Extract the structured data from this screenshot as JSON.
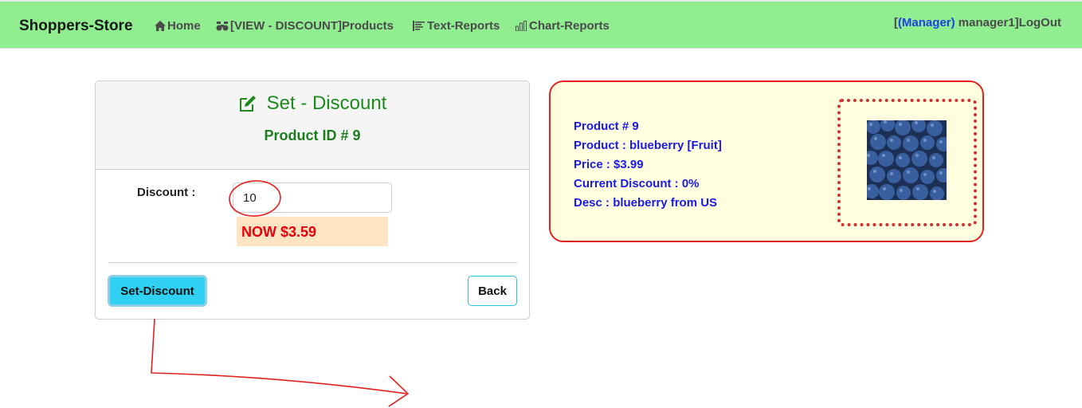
{
  "navbar": {
    "brand": "Shoppers-Store",
    "links": [
      {
        "label": "Home",
        "icon": "home-icon"
      },
      {
        "label": "[VIEW - DISCOUNT]Products",
        "icon": "binoculars-icon"
      },
      {
        "label": "Text-Reports",
        "icon": "text-report-icon"
      },
      {
        "label": "Chart-Reports",
        "icon": "bar-chart-icon"
      }
    ],
    "user": {
      "open": "[",
      "role": "(Manager)",
      "name": " manager1]",
      "logout": "LogOut"
    }
  },
  "form": {
    "title": "Set - Discount",
    "subtitle": "Product ID # 9",
    "discount_label": "Discount :",
    "discount_value": "10",
    "now_price": "NOW $3.59",
    "submit_label": "Set-Discount",
    "back_label": "Back"
  },
  "product": {
    "lines": [
      "Product # 9",
      "Product : blueberry [Fruit]",
      "Price : $3.99",
      "Current Discount : 0%",
      "Desc : blueberry from US"
    ],
    "image": "blueberry-photo"
  },
  "colors": {
    "navbar_bg": "#90ee90",
    "accent_green": "#1e8a1e",
    "info_text": "#1a1ae6",
    "button_cyan": "#2fd0f2",
    "annotation_red": "#e32020",
    "info_bg": "#ffffe0"
  }
}
